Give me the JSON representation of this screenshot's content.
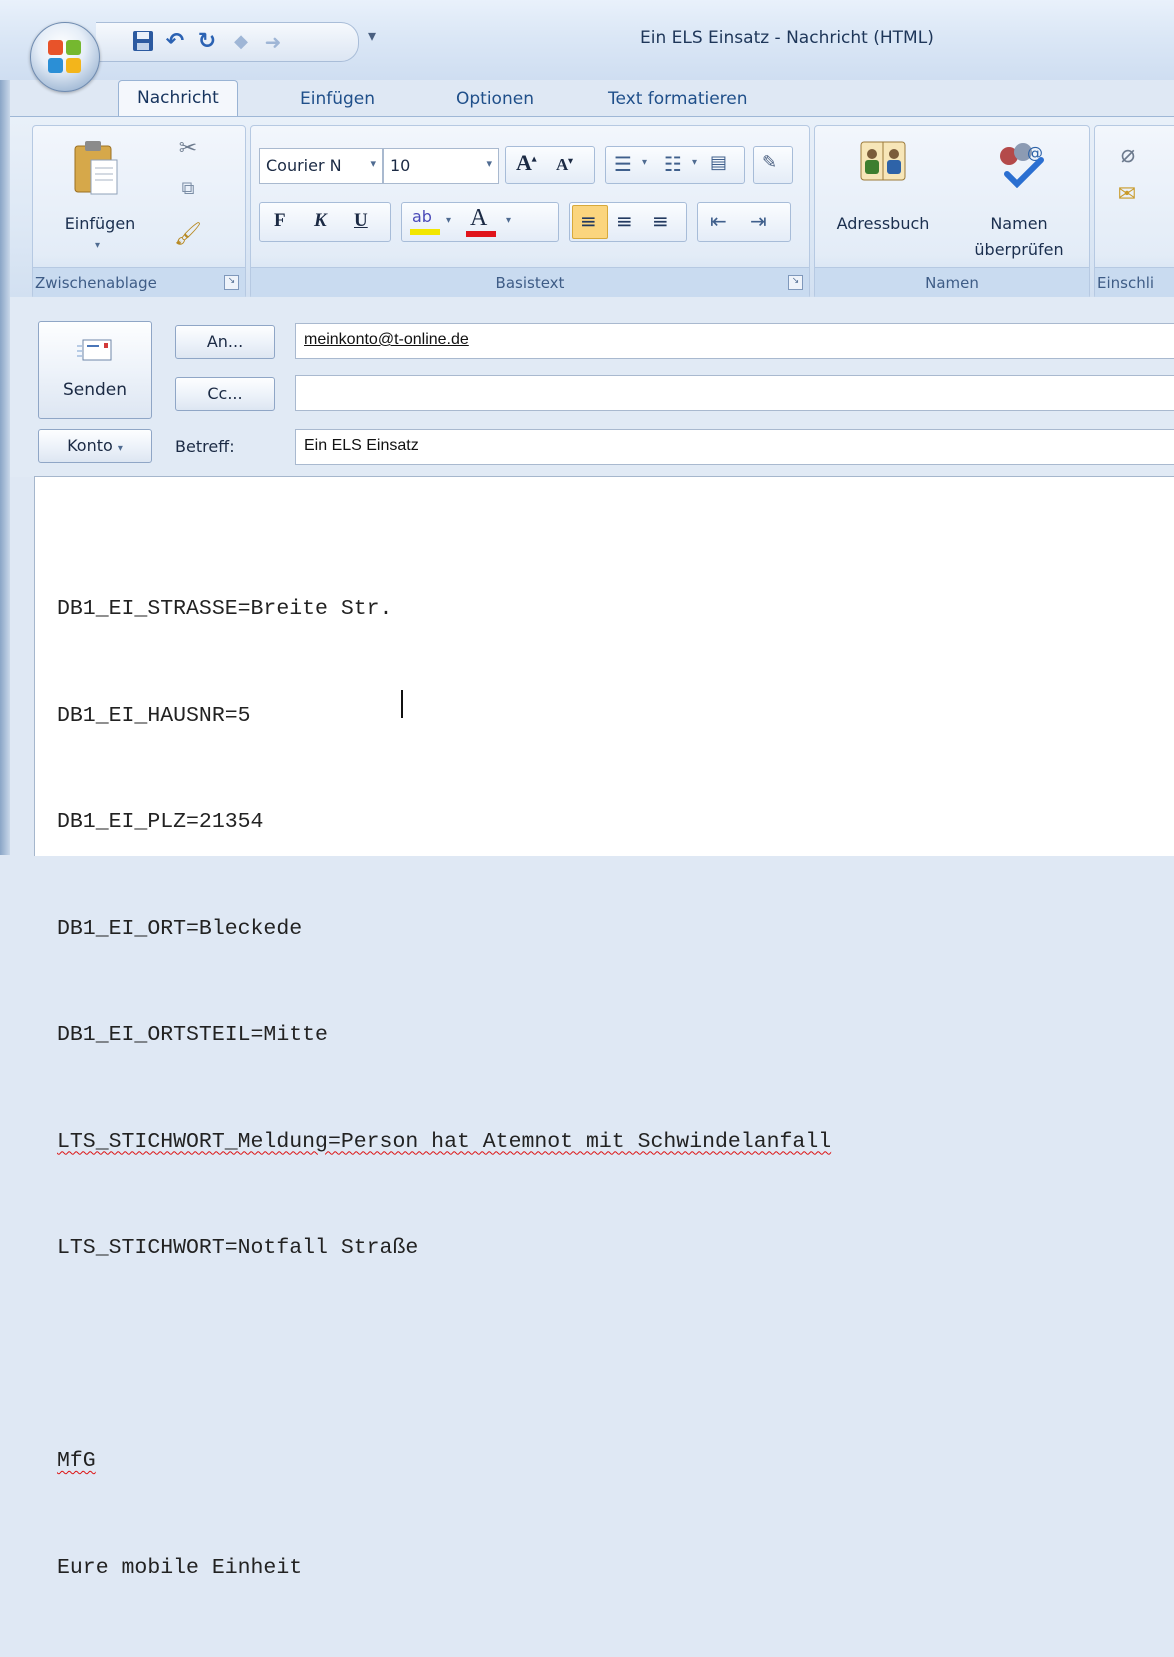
{
  "window": {
    "title": "Ein ELS Einsatz - Nachricht (HTML)"
  },
  "quick_access": {
    "items": [
      "save-icon",
      "undo-icon",
      "redo-icon",
      "prev-item-icon",
      "next-item-icon"
    ],
    "customize": "▾"
  },
  "tabs": [
    {
      "label": "Nachricht",
      "active": true
    },
    {
      "label": "Einfügen"
    },
    {
      "label": "Optionen"
    },
    {
      "label": "Text formatieren"
    }
  ],
  "ribbon": {
    "clipboard": {
      "label": "Zwischenablage",
      "paste_label": "Einfügen"
    },
    "basic_text": {
      "label": "Basistext",
      "font_name": "Courier N",
      "font_size": "10",
      "bold": "F",
      "italic": "K",
      "underline": "U"
    },
    "names": {
      "label": "Namen",
      "address_book": "Adressbuch",
      "check_names_1": "Namen",
      "check_names_2": "überprüfen"
    },
    "include": {
      "label": "Einschli"
    }
  },
  "header": {
    "send_label": "Senden",
    "to_button": "An...",
    "cc_button": "Cc...",
    "account_button": "Konto",
    "subject_label": "Betreff:",
    "to_value": "meinkonto@t-online.de",
    "cc_value": "",
    "subject_value": "Ein ELS Einsatz"
  },
  "body": {
    "lines": [
      "DB1_EI_STRASSE=Breite Str.",
      "DB1_EI_HAUSNR=5",
      "DB1_EI_PLZ=21354",
      "DB1_EI_ORT=Bleckede",
      "DB1_EI_ORTSTEIL=Mitte",
      "LTS_STICHWORT_Meldung=Person hat Atemnot mit Schwindelanfall",
      "LTS_STICHWORT=Notfall Straße",
      "",
      "MfG",
      "Eure mobile Einheit"
    ]
  },
  "colors": {
    "ribbon_bg": "#dde8f5",
    "tab_text": "#1f4f8a",
    "highlight_yellow": "#f2e600",
    "font_color_red": "#e0141b",
    "spell_error": "#d11111"
  }
}
